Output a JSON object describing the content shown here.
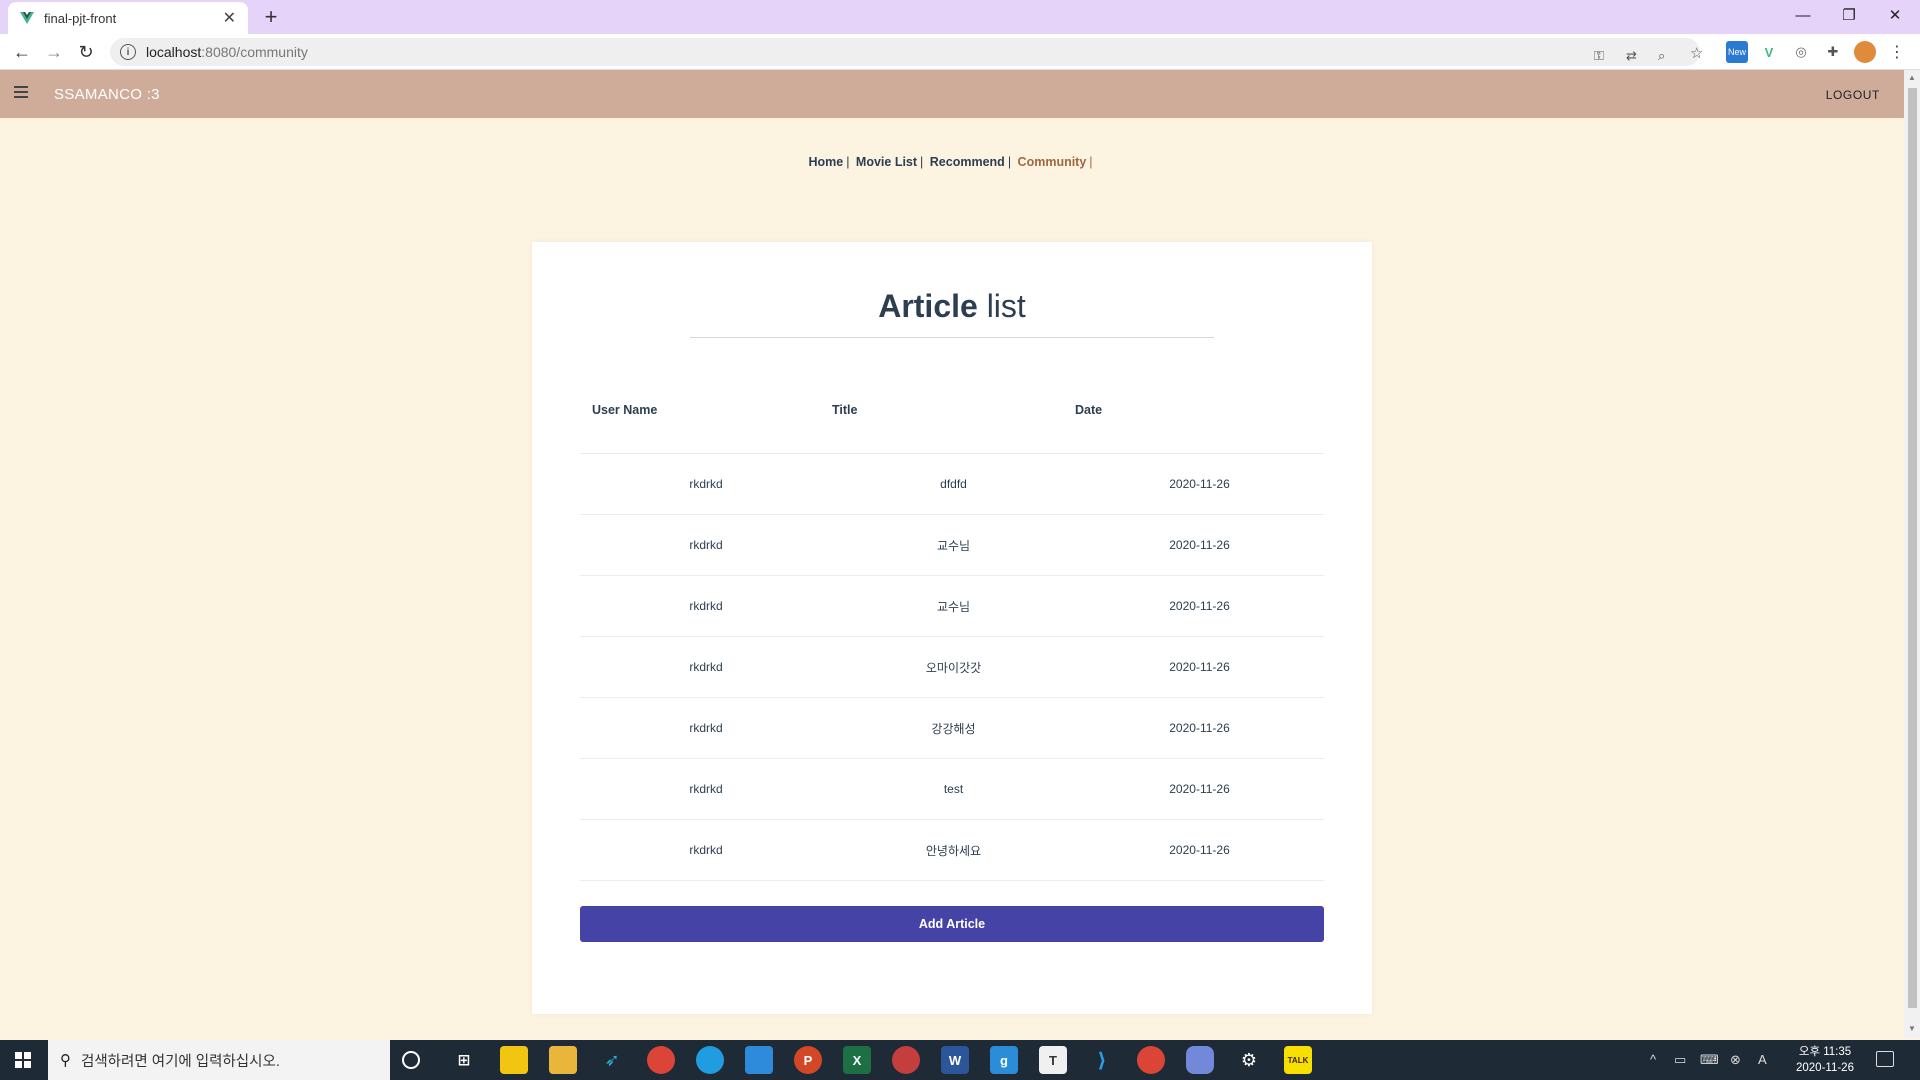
{
  "browser": {
    "tab_title": "final-pjt-front",
    "url_host": "localhost",
    "url_path": ":8080/community",
    "new_badge": "New"
  },
  "app": {
    "brand": "SSAMANCO :3",
    "logout_label": "LOGOUT"
  },
  "subnav": {
    "items": [
      "Home",
      "Movie List",
      "Recommend",
      "Community"
    ],
    "active": "Community"
  },
  "card": {
    "title_bold": "Article",
    "title_rest": "list",
    "columns": [
      "User Name",
      "Title",
      "Date"
    ],
    "rows": [
      {
        "user": "rkdrkd",
        "title": "dfdfd",
        "date": "2020-11-26"
      },
      {
        "user": "rkdrkd",
        "title": "교수님",
        "date": "2020-11-26"
      },
      {
        "user": "rkdrkd",
        "title": "교수님",
        "date": "2020-11-26"
      },
      {
        "user": "rkdrkd",
        "title": "오마이갓갓",
        "date": "2020-11-26"
      },
      {
        "user": "rkdrkd",
        "title": "강강해성",
        "date": "2020-11-26"
      },
      {
        "user": "rkdrkd",
        "title": "test",
        "date": "2020-11-26"
      },
      {
        "user": "rkdrkd",
        "title": "안녕하세요",
        "date": "2020-11-26"
      }
    ],
    "add_button": "Add Article"
  },
  "taskbar": {
    "search_placeholder": "검색하려면 여기에 입력하십시오.",
    "time": "오후 11:35",
    "date": "2020-11-26",
    "ime": "A"
  },
  "colors": {
    "appbar": "#cfac99",
    "background": "#fdf3e1",
    "button": "#4543a6",
    "active_link": "#a0683f"
  }
}
